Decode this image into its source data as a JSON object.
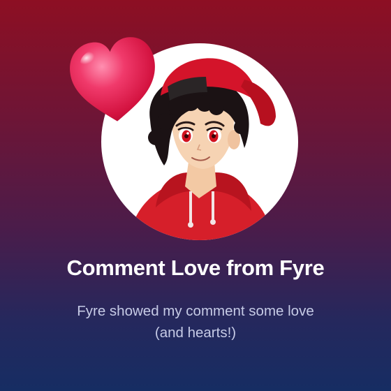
{
  "card": {
    "title": "Comment Love from Fyre",
    "subtitle_line1": "Fyre showed my comment some love",
    "subtitle_line2": "(and hearts!)"
  },
  "avatar": {
    "icon": "anime-boy-red-cap-avatar"
  },
  "decoration": {
    "icon": "heart-icon"
  },
  "colors": {
    "gradient_top": "#8d0f23",
    "gradient_bottom": "#162d63",
    "heart": "#e8245a",
    "hoodie": "#d61f2a"
  }
}
